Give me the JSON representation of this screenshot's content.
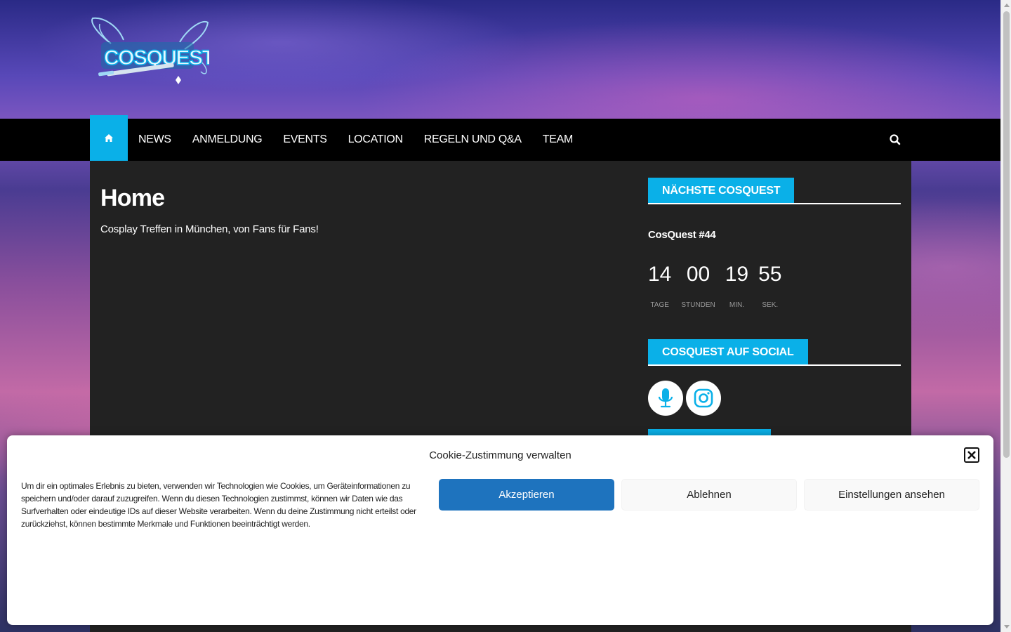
{
  "site": {
    "logo_text": "COSQUEST"
  },
  "nav": {
    "home_icon": "home-icon",
    "items": [
      {
        "label": "NEWS"
      },
      {
        "label": "ANMELDUNG"
      },
      {
        "label": "EVENTS"
      },
      {
        "label": "LOCATION"
      },
      {
        "label": "REGELN UND Q&A"
      },
      {
        "label": "TEAM"
      }
    ],
    "search_icon": "search-icon",
    "accent_color": "#0ab0e8"
  },
  "main": {
    "title": "Home",
    "description": "Cosplay Treffen in München, von Fans für Fans!"
  },
  "sidebar": {
    "countdown_widget": {
      "title": "NÄCHSTE COSQUEST",
      "event_name": "CosQuest #44",
      "units": [
        {
          "value": "14",
          "label": "TAGE"
        },
        {
          "value": "00",
          "label": "STUNDEN"
        },
        {
          "value": "19",
          "label": "MIN."
        },
        {
          "value": "55",
          "label": "SEK."
        }
      ]
    },
    "social_widget": {
      "title": "COSQUEST AUF SOCIAL",
      "links": [
        {
          "icon": "microphone-icon"
        },
        {
          "icon": "instagram-icon"
        }
      ]
    }
  },
  "cookie_banner": {
    "title": "Cookie-Zustimmung verwalten",
    "text": "Um dir ein optimales Erlebnis zu bieten, verwenden wir Technologien wie Cookies, um Geräteinformationen zu speichern und/oder darauf zuzugreifen. Wenn du diesen Technologien zustimmst, können wir Daten wie das Surfverhalten oder eindeutige IDs auf dieser Website verarbeiten. Wenn du deine Zustimmung nicht erteilst oder zurückziehst, können bestimmte Merkmale und Funktionen beeinträchtigt werden.",
    "accept_label": "Akzeptieren",
    "deny_label": "Ablehnen",
    "preferences_label": "Einstellungen ansehen",
    "accept_color": "#1e73be"
  }
}
